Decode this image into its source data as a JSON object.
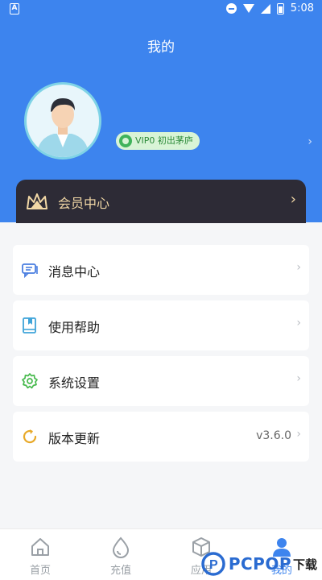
{
  "status_bar": {
    "time": "5:08",
    "left_icon": "A"
  },
  "header": {
    "title": "我的"
  },
  "profile": {
    "vip_label": "VIP0 初出茅庐",
    "chevron": "›"
  },
  "member_center": {
    "label": "会员中心",
    "chevron": "›"
  },
  "menu": [
    {
      "label": "消息中心",
      "icon": "message-icon",
      "chevron": "›"
    },
    {
      "label": "使用帮助",
      "icon": "book-icon",
      "chevron": "›"
    },
    {
      "label": "系统设置",
      "icon": "gear-icon",
      "chevron": "›"
    },
    {
      "label": "版本更新",
      "icon": "refresh-icon",
      "value": "v3.6.0",
      "chevron": "›"
    }
  ],
  "tabs": [
    {
      "label": "首页",
      "icon": "home-icon"
    },
    {
      "label": "充值",
      "icon": "drop-icon"
    },
    {
      "label": "应用",
      "icon": "box-icon"
    },
    {
      "label": "我的",
      "icon": "person-icon",
      "active": true
    }
  ],
  "watermark": {
    "logo": "P",
    "text": "PCPOP",
    "cn": "下载"
  },
  "colors": {
    "header_blue": "#3d84ee",
    "card_dark": "#2d2b36",
    "gold": "#f2d8a6",
    "vip_green": "#3fb35b"
  }
}
